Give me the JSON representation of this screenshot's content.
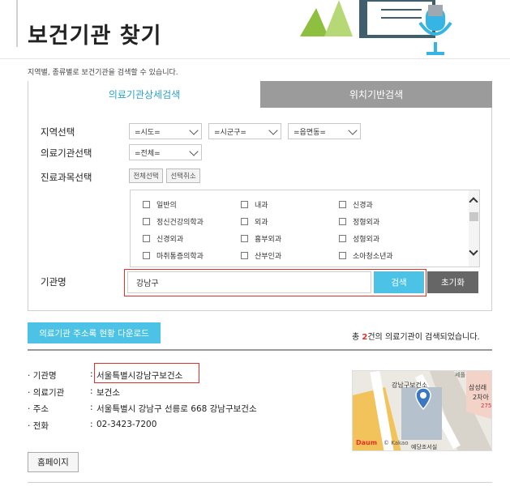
{
  "page": {
    "title": "보건기관 찾기",
    "subtitle": "지역별, 종류별로 보건기관을 검색할 수 있습니다."
  },
  "tabs": [
    {
      "label": "의료기관상세검색",
      "active": true
    },
    {
      "label": "위치기반검색",
      "active": false
    }
  ],
  "filters": {
    "region_label": "지역선택",
    "sido": "=시도=",
    "sigungu": "=시군구=",
    "eupmyeon": "=읍면동=",
    "institution_label": "의료기관선택",
    "institution_type": "=전체=",
    "department_label": "진료과목선택",
    "select_all": "전체선택",
    "deselect": "선택취소",
    "departments": [
      [
        "일반의",
        "내과",
        "신경과"
      ],
      [
        "정신건강의학과",
        "외과",
        "정형외과"
      ],
      [
        "신경외과",
        "흉부외과",
        "성형외과"
      ],
      [
        "마취통증의학과",
        "산부인과",
        "소아청소년과"
      ]
    ],
    "name_label": "기관명",
    "name_value": "강남구",
    "search_button": "검색",
    "reset_button": "초기화"
  },
  "results": {
    "download_button": "의료기관 주소록 현황 다운로드",
    "count_prefix": "총 ",
    "count": "2",
    "count_suffix": "건의 의료기관이 검색되었습니다."
  },
  "detail": {
    "rows": [
      {
        "key": "기관명",
        "value": "서울특별시강남구보건소"
      },
      {
        "key": "의료기관",
        "value": "보건소"
      },
      {
        "key": "주소",
        "value": "서울특별시 강남구 선릉로 668 강남구보건소"
      },
      {
        "key": "전화",
        "value": "02-3423-7200"
      }
    ],
    "homepage_button": "홈페이지"
  },
  "map": {
    "place_label": "강남구보건소",
    "nearby_label": "삼성래",
    "nearby_sub": "2차아",
    "nearby_num": "275",
    "top_label": "세플",
    "bottom_label": "예당조서실",
    "brand_daum": "Daum",
    "brand_kakao": "Kakao"
  },
  "colors": {
    "accent": "#4cc3e6",
    "highlight": "#e0302a",
    "tab_inactive": "#9b9b9b"
  }
}
